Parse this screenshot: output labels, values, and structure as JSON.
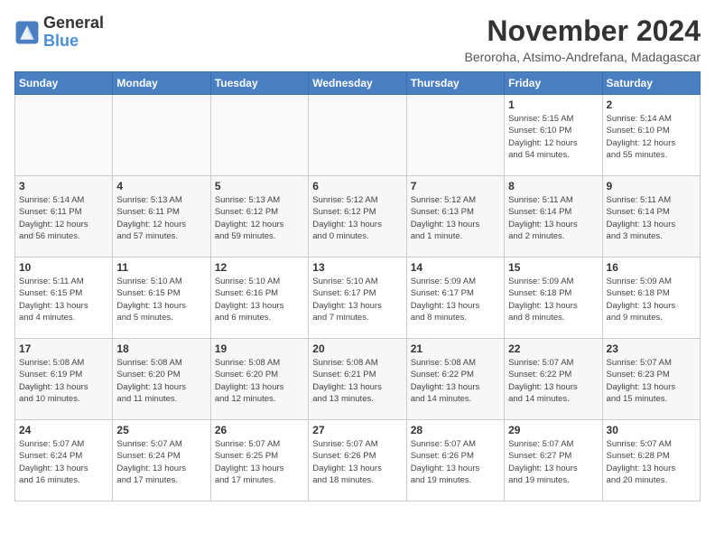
{
  "logo": {
    "line1": "General",
    "line2": "Blue"
  },
  "title": "November 2024",
  "subtitle": "Beroroha, Atsimo-Andrefana, Madagascar",
  "weekdays": [
    "Sunday",
    "Monday",
    "Tuesday",
    "Wednesday",
    "Thursday",
    "Friday",
    "Saturday"
  ],
  "weeks": [
    [
      {
        "day": "",
        "info": ""
      },
      {
        "day": "",
        "info": ""
      },
      {
        "day": "",
        "info": ""
      },
      {
        "day": "",
        "info": ""
      },
      {
        "day": "",
        "info": ""
      },
      {
        "day": "1",
        "info": "Sunrise: 5:15 AM\nSunset: 6:10 PM\nDaylight: 12 hours\nand 54 minutes."
      },
      {
        "day": "2",
        "info": "Sunrise: 5:14 AM\nSunset: 6:10 PM\nDaylight: 12 hours\nand 55 minutes."
      }
    ],
    [
      {
        "day": "3",
        "info": "Sunrise: 5:14 AM\nSunset: 6:11 PM\nDaylight: 12 hours\nand 56 minutes."
      },
      {
        "day": "4",
        "info": "Sunrise: 5:13 AM\nSunset: 6:11 PM\nDaylight: 12 hours\nand 57 minutes."
      },
      {
        "day": "5",
        "info": "Sunrise: 5:13 AM\nSunset: 6:12 PM\nDaylight: 12 hours\nand 59 minutes."
      },
      {
        "day": "6",
        "info": "Sunrise: 5:12 AM\nSunset: 6:12 PM\nDaylight: 13 hours\nand 0 minutes."
      },
      {
        "day": "7",
        "info": "Sunrise: 5:12 AM\nSunset: 6:13 PM\nDaylight: 13 hours\nand 1 minute."
      },
      {
        "day": "8",
        "info": "Sunrise: 5:11 AM\nSunset: 6:14 PM\nDaylight: 13 hours\nand 2 minutes."
      },
      {
        "day": "9",
        "info": "Sunrise: 5:11 AM\nSunset: 6:14 PM\nDaylight: 13 hours\nand 3 minutes."
      }
    ],
    [
      {
        "day": "10",
        "info": "Sunrise: 5:11 AM\nSunset: 6:15 PM\nDaylight: 13 hours\nand 4 minutes."
      },
      {
        "day": "11",
        "info": "Sunrise: 5:10 AM\nSunset: 6:15 PM\nDaylight: 13 hours\nand 5 minutes."
      },
      {
        "day": "12",
        "info": "Sunrise: 5:10 AM\nSunset: 6:16 PM\nDaylight: 13 hours\nand 6 minutes."
      },
      {
        "day": "13",
        "info": "Sunrise: 5:10 AM\nSunset: 6:17 PM\nDaylight: 13 hours\nand 7 minutes."
      },
      {
        "day": "14",
        "info": "Sunrise: 5:09 AM\nSunset: 6:17 PM\nDaylight: 13 hours\nand 8 minutes."
      },
      {
        "day": "15",
        "info": "Sunrise: 5:09 AM\nSunset: 6:18 PM\nDaylight: 13 hours\nand 8 minutes."
      },
      {
        "day": "16",
        "info": "Sunrise: 5:09 AM\nSunset: 6:18 PM\nDaylight: 13 hours\nand 9 minutes."
      }
    ],
    [
      {
        "day": "17",
        "info": "Sunrise: 5:08 AM\nSunset: 6:19 PM\nDaylight: 13 hours\nand 10 minutes."
      },
      {
        "day": "18",
        "info": "Sunrise: 5:08 AM\nSunset: 6:20 PM\nDaylight: 13 hours\nand 11 minutes."
      },
      {
        "day": "19",
        "info": "Sunrise: 5:08 AM\nSunset: 6:20 PM\nDaylight: 13 hours\nand 12 minutes."
      },
      {
        "day": "20",
        "info": "Sunrise: 5:08 AM\nSunset: 6:21 PM\nDaylight: 13 hours\nand 13 minutes."
      },
      {
        "day": "21",
        "info": "Sunrise: 5:08 AM\nSunset: 6:22 PM\nDaylight: 13 hours\nand 14 minutes."
      },
      {
        "day": "22",
        "info": "Sunrise: 5:07 AM\nSunset: 6:22 PM\nDaylight: 13 hours\nand 14 minutes."
      },
      {
        "day": "23",
        "info": "Sunrise: 5:07 AM\nSunset: 6:23 PM\nDaylight: 13 hours\nand 15 minutes."
      }
    ],
    [
      {
        "day": "24",
        "info": "Sunrise: 5:07 AM\nSunset: 6:24 PM\nDaylight: 13 hours\nand 16 minutes."
      },
      {
        "day": "25",
        "info": "Sunrise: 5:07 AM\nSunset: 6:24 PM\nDaylight: 13 hours\nand 17 minutes."
      },
      {
        "day": "26",
        "info": "Sunrise: 5:07 AM\nSunset: 6:25 PM\nDaylight: 13 hours\nand 17 minutes."
      },
      {
        "day": "27",
        "info": "Sunrise: 5:07 AM\nSunset: 6:26 PM\nDaylight: 13 hours\nand 18 minutes."
      },
      {
        "day": "28",
        "info": "Sunrise: 5:07 AM\nSunset: 6:26 PM\nDaylight: 13 hours\nand 19 minutes."
      },
      {
        "day": "29",
        "info": "Sunrise: 5:07 AM\nSunset: 6:27 PM\nDaylight: 13 hours\nand 19 minutes."
      },
      {
        "day": "30",
        "info": "Sunrise: 5:07 AM\nSunset: 6:28 PM\nDaylight: 13 hours\nand 20 minutes."
      }
    ]
  ]
}
